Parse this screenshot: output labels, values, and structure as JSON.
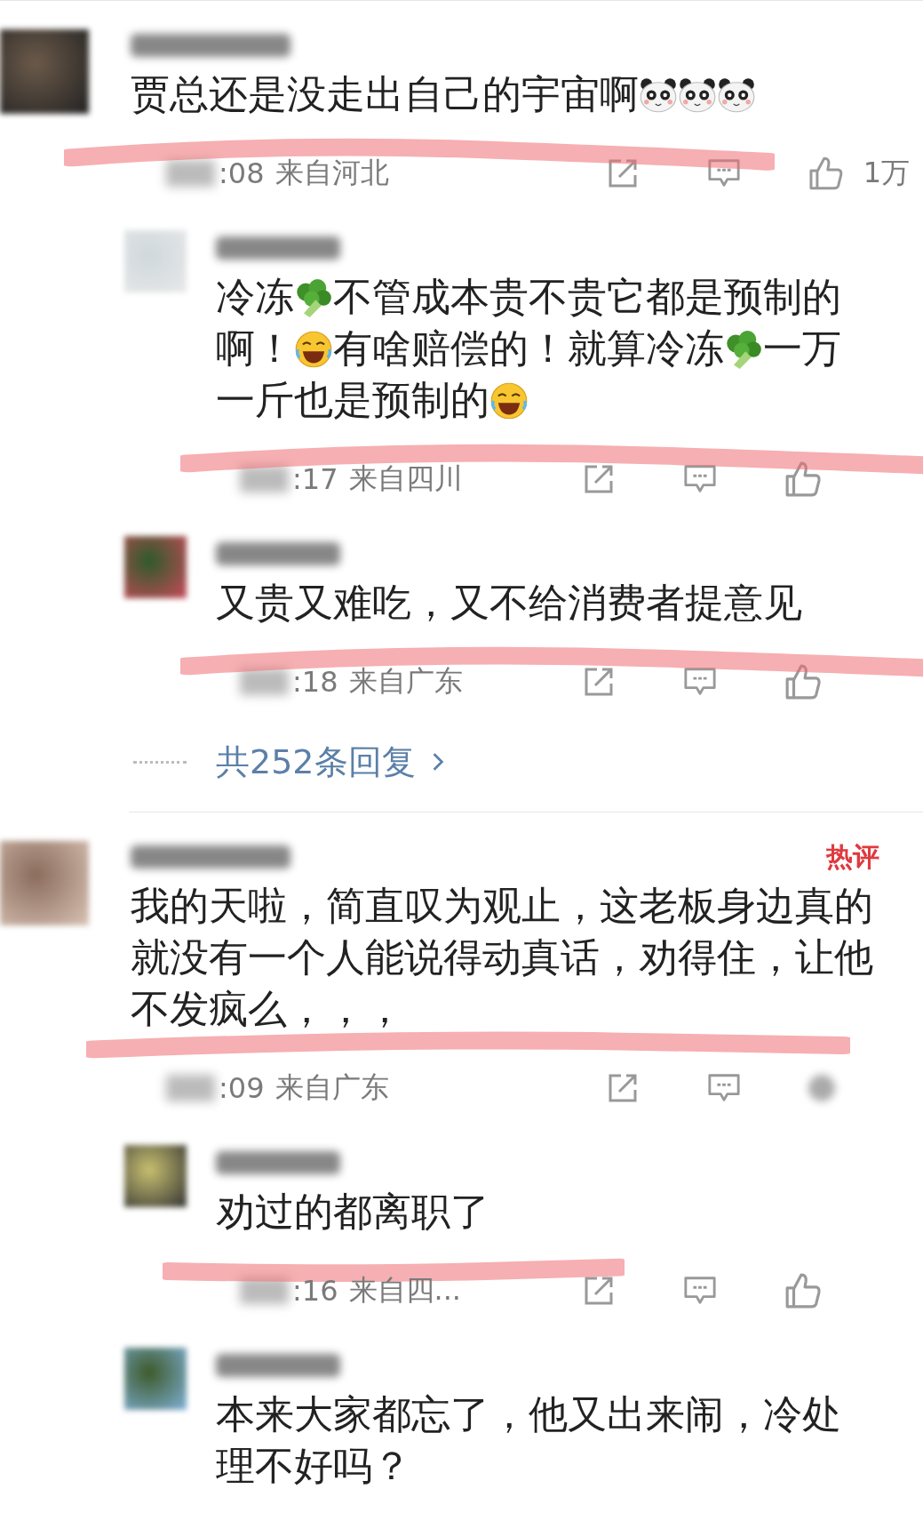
{
  "comments": [
    {
      "content": [
        {
          "kind": "text",
          "text": "贾总还是没走出自己的宇宙啊"
        },
        {
          "kind": "panda"
        },
        {
          "kind": "panda"
        },
        {
          "kind": "panda"
        }
      ],
      "meta": {
        "time": ":08",
        "location": "来自河北",
        "likes": "1万",
        "like_hidden": false,
        "strike": {
          "kind": "over"
        }
      },
      "replies": [
        {
          "content": [
            {
              "kind": "text",
              "text": "冷冻"
            },
            {
              "kind": "broccoli"
            },
            {
              "kind": "text",
              "text": "不管成本贵不贵它都是预制的啊！"
            },
            {
              "kind": "laugh"
            },
            {
              "kind": "text",
              "text": "有啥赔偿的！就算冷冻"
            },
            {
              "kind": "broccoli"
            },
            {
              "kind": "text",
              "text": "一万一斤也是预制的"
            },
            {
              "kind": "laugh"
            }
          ],
          "meta": {
            "time": ":17",
            "location": "来自四川",
            "like_hidden": false,
            "strike": {
              "kind": "over"
            }
          }
        },
        {
          "content": [
            {
              "kind": "text",
              "text": "又贵又难吃，又不给消费者提意见"
            }
          ],
          "meta": {
            "time": ":18",
            "location": "来自广东",
            "like_hidden": false,
            "strike": {
              "kind": "over"
            }
          }
        }
      ],
      "more_replies": "共252条回复"
    },
    {
      "hot_badge": "热评",
      "content": [
        {
          "kind": "text",
          "text": "我的天啦，简直叹为观止，这老板身边真的就没有一个人能说得动真话，劝得住，让他不发疯么，，，"
        }
      ],
      "meta": {
        "time": ":09",
        "location": "来自广东",
        "like_hidden": true,
        "strike": {
          "kind": "above"
        }
      },
      "replies": [
        {
          "content": [
            {
              "kind": "text",
              "text": "劝过的都离职了"
            }
          ],
          "meta": {
            "time": ":16",
            "location": "来自四...",
            "like_hidden": false,
            "strike": {
              "kind": "left"
            }
          }
        },
        {
          "content": [
            {
              "kind": "text",
              "text": "本来大家都忘了，他又出来闹，冷处理不好吗？"
            }
          ]
        }
      ]
    }
  ]
}
